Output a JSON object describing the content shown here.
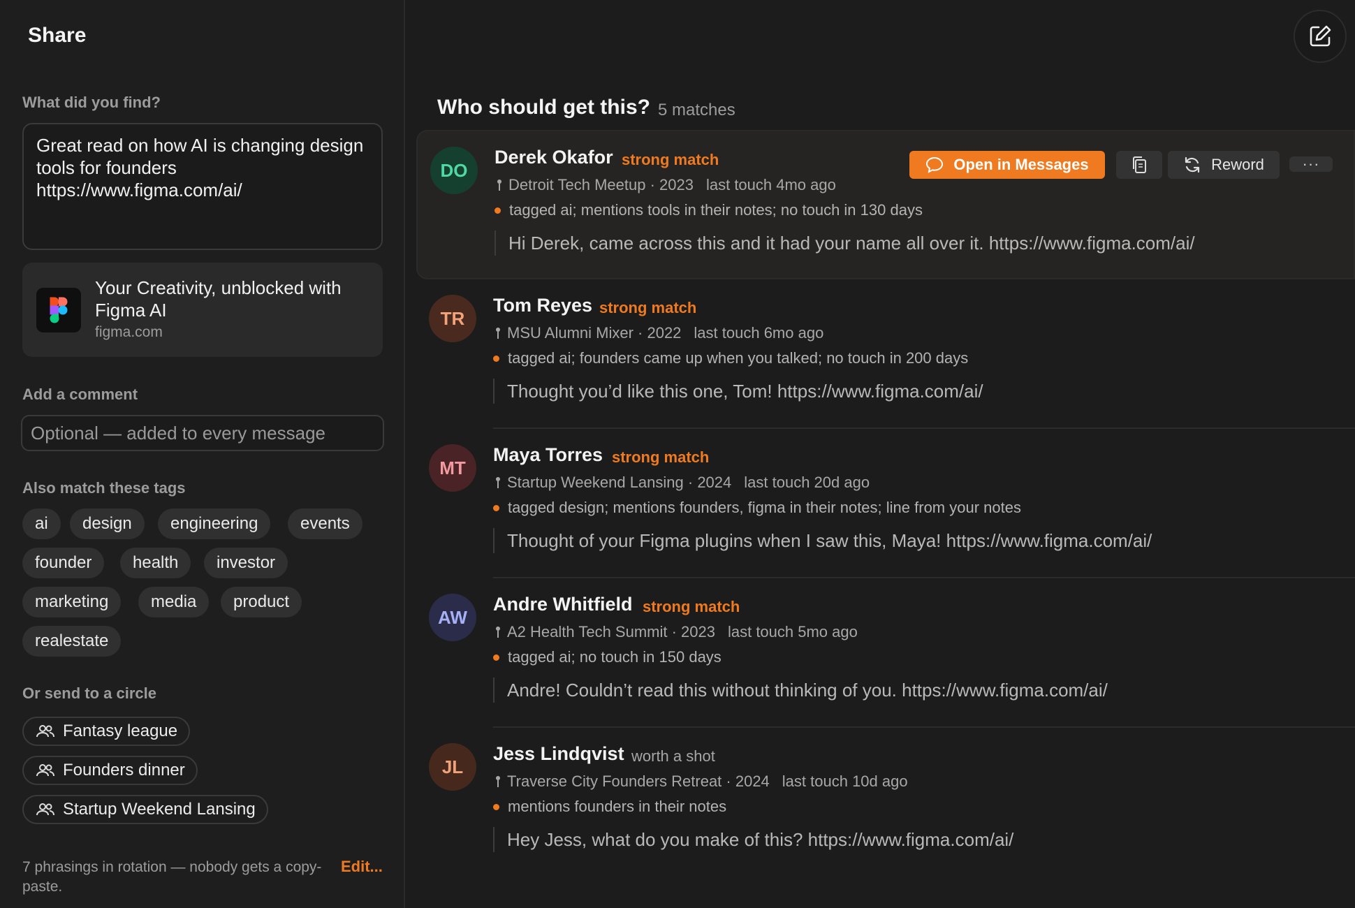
{
  "left": {
    "title": "Share",
    "find_label": "What did you find?",
    "find_text": "Great read on how AI is changing design tools for founders https://www.figma.com/ai/",
    "link_card": {
      "title": "Your Creativity, unblocked with Figma AI",
      "domain": "figma.com",
      "icon": "figma-logo"
    },
    "comment_label": "Add a comment",
    "comment_placeholder": "Optional — added to every message",
    "tags_label": "Also match these tags",
    "tags": [
      "ai",
      "design",
      "engineering",
      "events",
      "founder",
      "health",
      "investor",
      "marketing",
      "media",
      "product",
      "realestate"
    ],
    "circles_label": "Or send to a circle",
    "circles": [
      "Fantasy league",
      "Founders dinner",
      "Startup Weekend Lansing"
    ],
    "footer_note": "7 phrasings in rotation — nobody gets a copy-paste.",
    "edit_label": "Edit..."
  },
  "right": {
    "title": "Who should get this?",
    "match_count": "5 matches",
    "actions": {
      "open_label": "Open in Messages",
      "reword_label": "Reword",
      "more_label": "···",
      "copy_icon": "copy-icon"
    },
    "matches": [
      {
        "initials": "DO",
        "name": "Derek Okafor",
        "badge": "strong match",
        "meta": "Detroit Tech Meetup · 2023",
        "last_touch": "last touch 4mo ago",
        "reason_pre": "tagged ai; mentions tools in their notes; no touch in ",
        "reason_num": "130",
        "reason_post": " days",
        "message": "Hi Derek, came across this and it had your name all over it. https://www.figma.com/ai/",
        "avatar_bg": "#15402f",
        "avatar_fg": "#4fd9a4"
      },
      {
        "initials": "TR",
        "name": "Tom Reyes",
        "badge": "strong match",
        "meta": "MSU Alumni Mixer · 2022",
        "last_touch": "last touch 6mo ago",
        "reason_pre": "tagged ai; founders came up when you talked; no touch in ",
        "reason_num": "200",
        "reason_post": " days",
        "message": "Thought you’d like this one, Tom! https://www.figma.com/ai/",
        "avatar_bg": "#4a2a1e",
        "avatar_fg": "#f2a37a"
      },
      {
        "initials": "MT",
        "name": "Maya Torres",
        "badge": "strong match",
        "meta": "Startup Weekend Lansing · 2024",
        "last_touch": "last touch 20d ago",
        "reason_pre": "tagged design; mentions founders, figma in their notes; line from your notes",
        "reason_num": "",
        "reason_post": "",
        "message": "Thought of your Figma plugins when I saw this, Maya! https://www.figma.com/ai/",
        "avatar_bg": "#4a2327",
        "avatar_fg": "#f29aa0"
      },
      {
        "initials": "AW",
        "name": "Andre Whitfield",
        "badge": "strong match",
        "meta": "A2 Health Tech Summit · 2023",
        "last_touch": "last touch 5mo ago",
        "reason_pre": "tagged ai; no touch in ",
        "reason_num": "150",
        "reason_post": " days",
        "message": "Andre! Couldn’t read this without thinking of you. https://www.figma.com/ai/",
        "avatar_bg": "#2a2c4a",
        "avatar_fg": "#a6b0f5"
      },
      {
        "initials": "JL",
        "name": "Jess Lindqvist",
        "badge": "worth a shot",
        "meta": "Traverse City Founders Retreat · 2024",
        "last_touch": "last touch 10d ago",
        "reason_pre": "mentions founders in their notes",
        "reason_num": "",
        "reason_post": "",
        "message": "Hey Jess, what do you make of this? https://www.figma.com/ai/",
        "avatar_bg": "#47281d",
        "avatar_fg": "#f0a27b"
      }
    ]
  },
  "colors": {
    "accent": "#f07a20",
    "background": "#1c1c1d"
  }
}
